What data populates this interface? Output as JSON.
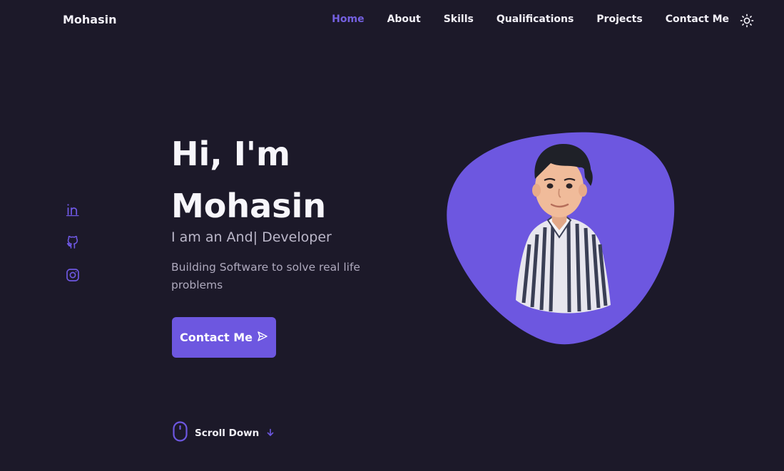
{
  "header": {
    "logo": "Mohasin",
    "nav": [
      {
        "label": "Home",
        "active": true
      },
      {
        "label": "About",
        "active": false
      },
      {
        "label": "Skills",
        "active": false
      },
      {
        "label": "Qualifications",
        "active": false
      },
      {
        "label": "Projects",
        "active": false
      },
      {
        "label": "Contact Me",
        "active": false
      }
    ],
    "theme_toggle_icon": "sun-icon"
  },
  "social": [
    {
      "icon": "linkedin-icon"
    },
    {
      "icon": "github-icon"
    },
    {
      "icon": "instagram-icon"
    }
  ],
  "hero": {
    "title_line1": "Hi, I'm",
    "title_line2": "Mohasin",
    "subtitle": "I am an And| Developer",
    "description": "Building Software to solve real life problems",
    "contact_button": "Contact Me",
    "contact_button_icon": "send-icon",
    "scroll_label": "Scroll Down",
    "scroll_icon": "mouse-icon",
    "scroll_arrow_icon": "arrow-down-icon",
    "image": "avatar-illustration"
  },
  "colors": {
    "background": "#1c1929",
    "accent": "#6d57e0",
    "text": "#f2f0f7",
    "muted": "#aea9bd"
  }
}
